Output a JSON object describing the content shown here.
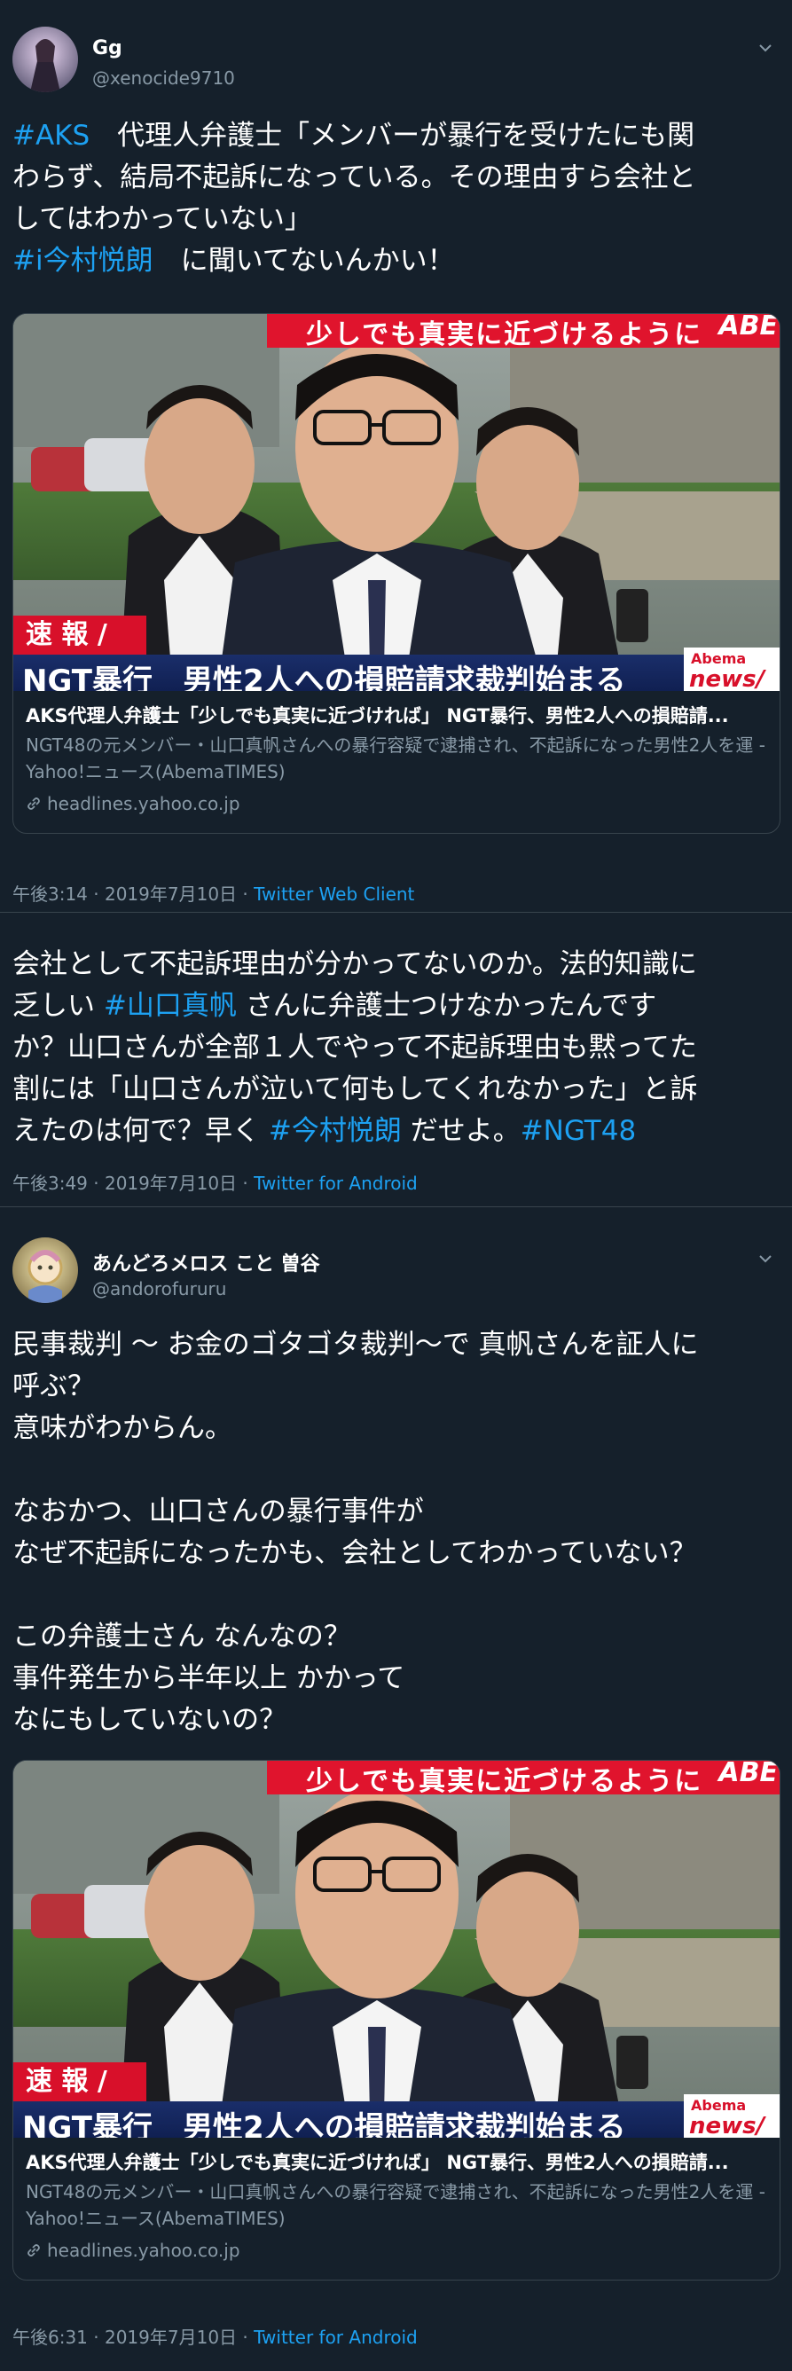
{
  "tweets": [
    {
      "name": "Gg",
      "handle": "@xenocide9710",
      "lines": [
        [
          {
            "t": "#AKS",
            "tag": true
          },
          {
            "t": "　代理人弁護士「メンバーが暴行を受けたにも関"
          }
        ],
        [
          {
            "t": "わらず、結局不起訴になっている。その理由すら会社と"
          }
        ],
        [
          {
            "t": "してはわかっていない」"
          }
        ],
        [
          {
            "t": "#i今村悦朗",
            "tag": true
          },
          {
            "t": "　に聞いてないんかい！"
          }
        ]
      ],
      "card": {
        "banner_top": "少しでも真実に近づけるように",
        "abema_top": "ABE",
        "flash_label": "速 報 /",
        "headline": "NGT暴行　男性2人への損賠請求裁判始まる",
        "logo_top": "Abema",
        "logo_bottom": "news/",
        "title": "AKS代理人弁護士「少しでも真実に近づければ」 NGT暴行、男性2人への損賠請...",
        "desc": "NGT48の元メンバー・山口真帆さんへの暴行容疑で逮捕され、不起訴になった男性2人を運 - Yahoo!ニュース(AbemaTIMES)",
        "domain": "headlines.yahoo.co.jp"
      },
      "time": "午後3:14 · 2019年7月10日 · ",
      "source": "Twitter Web Client"
    },
    {
      "lines": [
        [
          {
            "t": "会社として不起訴理由が分かってないのか。法的知識に"
          }
        ],
        [
          {
            "t": "乏しい "
          },
          {
            "t": "#山口真帆",
            "tag": true
          },
          {
            "t": " さんに弁護士つけなかったんです"
          }
        ],
        [
          {
            "t": "か？山口さんが全部１人でやって不起訴理由も黙ってた"
          }
        ],
        [
          {
            "t": "割には「山口さんが泣いて何もしてくれなかった」と訴"
          }
        ],
        [
          {
            "t": "えたのは何で？早く "
          },
          {
            "t": "#今村悦朗",
            "tag": true
          },
          {
            "t": " だせよ。"
          },
          {
            "t": "#NGT48",
            "tag": true
          }
        ]
      ],
      "time": "午後3:49 · 2019年7月10日 · ",
      "source": "Twitter for Android"
    },
    {
      "name": "あんどろメロス こと 曽谷",
      "handle": "@andorofururu",
      "lines": [
        [
          {
            "t": "民事裁判 ～ お金のゴタゴタ裁判～で 真帆さんを証人に"
          }
        ],
        [
          {
            "t": "呼ぶ？"
          }
        ],
        [
          {
            "t": "意味がわからん。"
          }
        ],
        [
          {
            "t": ""
          }
        ],
        [
          {
            "t": "なおかつ、山口さんの暴行事件が"
          }
        ],
        [
          {
            "t": "なぜ不起訴になったかも、会社としてわかっていない？"
          }
        ],
        [
          {
            "t": ""
          }
        ],
        [
          {
            "t": "この弁護士さん なんなの？"
          }
        ],
        [
          {
            "t": "事件発生から半年以上 かかって"
          }
        ],
        [
          {
            "t": "なにもしていないの？"
          }
        ]
      ],
      "card": {
        "banner_top": "少しでも真実に近づけるように",
        "abema_top": "ABE",
        "flash_label": "速 報 /",
        "headline": "NGT暴行　男性2人への損賠請求裁判始まる",
        "logo_top": "Abema",
        "logo_bottom": "news/",
        "title": "AKS代理人弁護士「少しでも真実に近づければ」 NGT暴行、男性2人への損賠請...",
        "desc": "NGT48の元メンバー・山口真帆さんへの暴行容疑で逮捕され、不起訴になった男性2人を運 - Yahoo!ニュース(AbemaTIMES)",
        "domain": "headlines.yahoo.co.jp"
      },
      "time": "午後6:31 · 2019年7月10日 · ",
      "source": "Twitter for Android"
    }
  ],
  "colors": {
    "bg": "#15202b",
    "accent": "#1da1f2",
    "muted": "#8899a6",
    "border": "#38444d",
    "banner_red": "#e0142d"
  }
}
